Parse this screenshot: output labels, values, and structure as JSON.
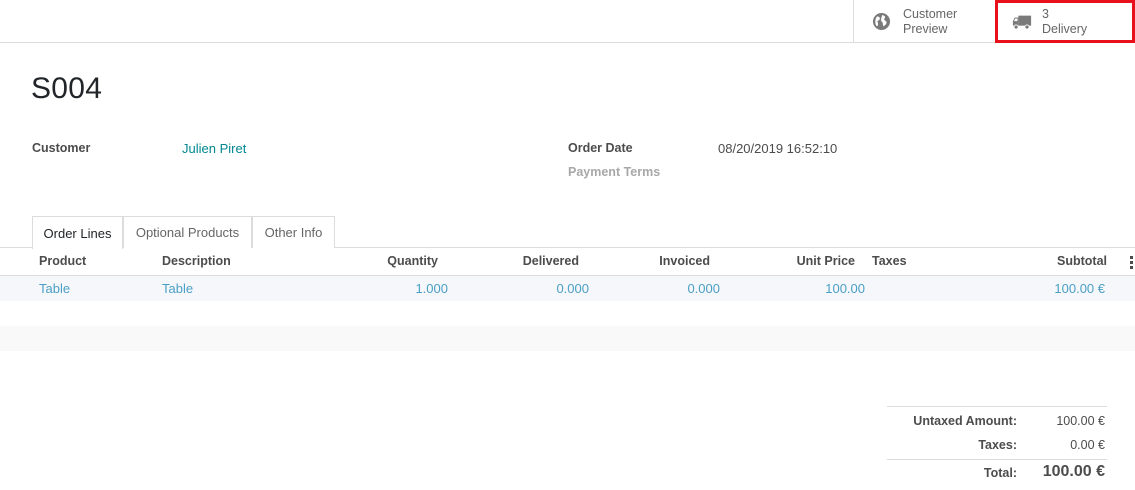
{
  "button_box": {
    "preview": {
      "label_line1": "Customer",
      "label_line2": "Preview",
      "icon": "globe-icon"
    },
    "delivery": {
      "count": "3",
      "label": "Delivery",
      "icon": "truck-icon"
    }
  },
  "record": {
    "name": "S004"
  },
  "fields": {
    "customer_label": "Customer",
    "customer_value": "Julien Piret",
    "order_date_label": "Order Date",
    "order_date_value": "08/20/2019 16:52:10",
    "payment_terms_label": "Payment Terms",
    "payment_terms_value": ""
  },
  "tabs": [
    {
      "label": "Order Lines",
      "active": true
    },
    {
      "label": "Optional Products",
      "active": false
    },
    {
      "label": "Other Info",
      "active": false
    }
  ],
  "table": {
    "headers": [
      "Product",
      "Description",
      "Quantity",
      "Delivered",
      "Invoiced",
      "Unit Price",
      "Taxes",
      "Subtotal"
    ],
    "rows": [
      {
        "product": "Table",
        "description": "Table",
        "quantity": "1.000",
        "delivered": "0.000",
        "invoiced": "0.000",
        "unit_price": "100.00",
        "taxes": "",
        "subtotal": "100.00 €"
      }
    ]
  },
  "totals": {
    "untaxed_label": "Untaxed Amount:",
    "untaxed_value": "100.00 €",
    "taxes_label": "Taxes:",
    "taxes_value": "0.00 €",
    "total_label": "Total:",
    "total_value": "100.00 €"
  },
  "colors": {
    "link": "#00878f",
    "row_link": "#4b9fc6",
    "highlight": "#e8111b"
  }
}
